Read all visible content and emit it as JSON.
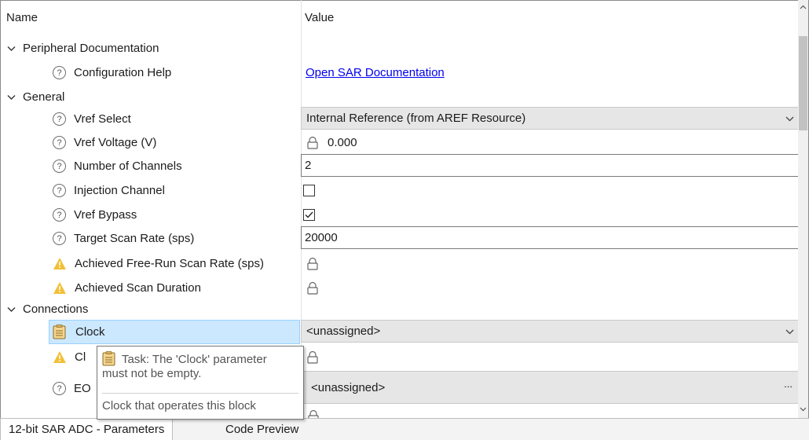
{
  "header": {
    "name_col": "Name",
    "value_col": "Value"
  },
  "sections": {
    "peripheral_docs": "Peripheral Documentation",
    "general": "General",
    "connections": "Connections"
  },
  "rows": {
    "config_help": {
      "label": "Configuration Help",
      "value": "Open SAR Documentation"
    },
    "vref_select": {
      "label": "Vref Select",
      "value": "Internal Reference (from AREF Resource)"
    },
    "vref_voltage": {
      "label": "Vref Voltage (V)",
      "value": "0.000"
    },
    "num_channels": {
      "label": "Number of Channels",
      "value": "2"
    },
    "injection_channel": {
      "label": "Injection Channel",
      "checked": false
    },
    "vref_bypass": {
      "label": "Vref Bypass",
      "checked": true
    },
    "target_scan_rate": {
      "label": "Target Scan Rate (sps)",
      "value": "20000"
    },
    "achieved_freerun": {
      "label": "Achieved Free-Run Scan Rate (sps)"
    },
    "achieved_duration": {
      "label": "Achieved Scan Duration"
    },
    "clock": {
      "label": "Clock",
      "value": "<unassigned>"
    },
    "clock2": {
      "label": "Cl"
    },
    "eoc": {
      "label": "EO",
      "value": "<unassigned>",
      "button": "..."
    }
  },
  "tooltip": {
    "line1": "Task: The 'Clock' parameter",
    "line2": "must not be empty.",
    "line3": "Clock that operates this block"
  },
  "tabs": [
    "12-bit SAR ADC - Parameters",
    "Code Preview"
  ],
  "icons": {
    "help": "?",
    "chevron": "❯"
  },
  "colors": {
    "accent_link": "#0000ee",
    "selection": "#cce8ff",
    "warning": "#f2c037"
  }
}
